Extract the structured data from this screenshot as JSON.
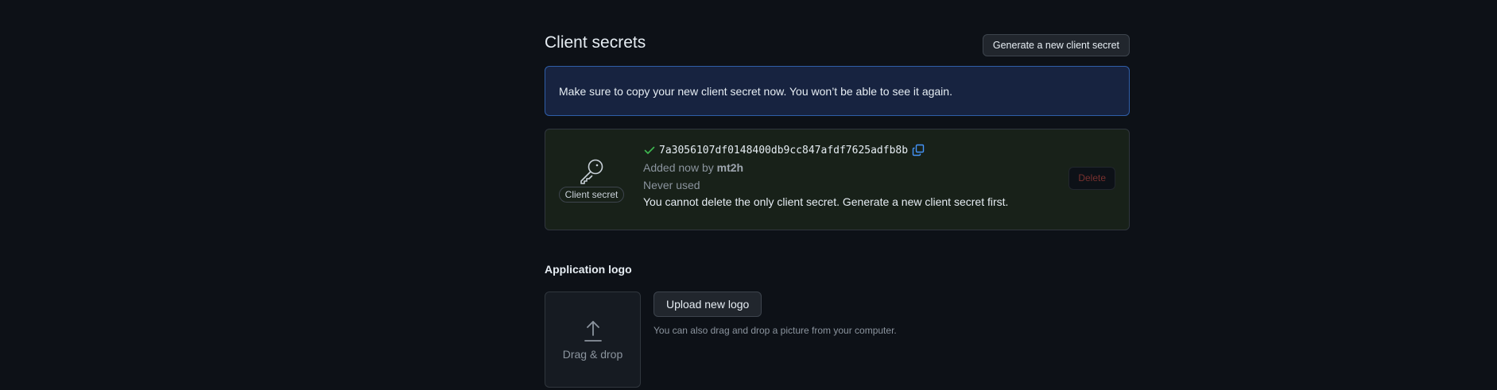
{
  "client_secrets": {
    "title": "Client secrets",
    "generate_button": "Generate a new client secret",
    "flash_message": "Make sure to copy your new client secret now. You won’t be able to see it again.",
    "secret": {
      "badge": "Client secret",
      "value": "7a3056107df0148400db9cc847afdf7625adfb8b",
      "added_prefix": "Added now by",
      "added_by": "mt2h",
      "usage": "Never used",
      "notice": "You cannot delete the only client secret. Generate a new client secret first.",
      "delete_button": "Delete"
    }
  },
  "application_logo": {
    "title": "Application logo",
    "dropzone_label": "Drag & drop",
    "upload_button": "Upload new logo",
    "hint": "You can also drag and drop a picture from your computer."
  },
  "icons": {
    "key": "key-icon",
    "check": "check-icon",
    "copy": "copy-icon",
    "upload": "upload-icon"
  },
  "colors": {
    "background": "#0d1117",
    "flash_bg": "#172340",
    "flash_border": "#2f5ea8",
    "success": "#3fb950",
    "accent": "#4493f8",
    "danger_muted": "#78312f"
  }
}
